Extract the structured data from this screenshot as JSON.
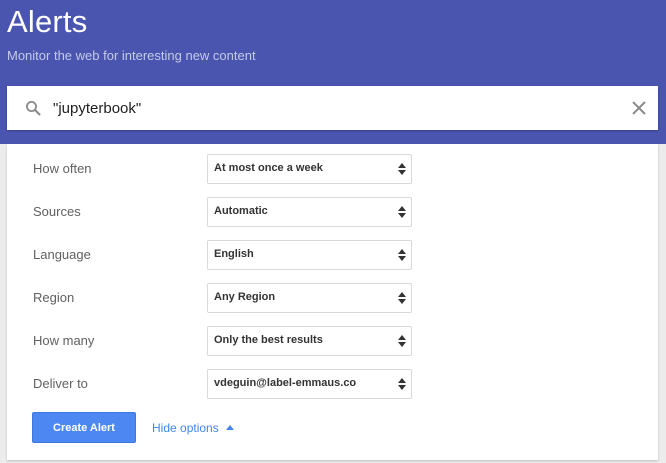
{
  "header": {
    "title": "Alerts",
    "subtitle": "Monitor the web for interesting new content",
    "color": "#4a55af"
  },
  "search": {
    "value": "\"jupyterbook\"",
    "search_icon": "search-icon",
    "clear_icon": "close-icon"
  },
  "options": [
    {
      "label": "How often",
      "value": "At most once a week"
    },
    {
      "label": "Sources",
      "value": "Automatic"
    },
    {
      "label": "Language",
      "value": "English"
    },
    {
      "label": "Region",
      "value": "Any Region"
    },
    {
      "label": "How many",
      "value": "Only the best results"
    },
    {
      "label": "Deliver to",
      "value": "vdeguin@label-emmaus.co"
    }
  ],
  "actions": {
    "create_label": "Create Alert",
    "hide_options_label": "Hide options",
    "accent_color": "#4285f4"
  }
}
